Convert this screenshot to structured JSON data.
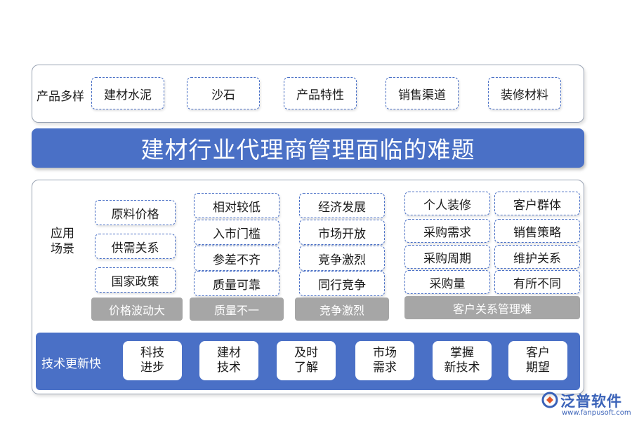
{
  "top": {
    "label": "产品多样",
    "items": [
      "建材水泥",
      "沙石",
      "产品特性",
      "销售渠道",
      "装修材料"
    ]
  },
  "title": "建材行业代理商管理面临的难题",
  "scenario": {
    "label_line1": "应用",
    "label_line2": "场景",
    "col1": {
      "items": [
        "原料价格",
        "供需关系",
        "国家政策"
      ],
      "footer": "价格波动大"
    },
    "col2": {
      "items": [
        "相对较低",
        "入市门槛",
        "参差不齐",
        "质量可靠"
      ],
      "footer": "质量不一"
    },
    "col3": {
      "items": [
        "经济发展",
        "市场开放",
        "竞争激烈",
        "同行竞争"
      ],
      "footer": "竞争激烈"
    },
    "col4": {
      "left": [
        "个人装修",
        "采购需求",
        "采购周期",
        "采购量"
      ],
      "right": [
        "客户群体",
        "销售策略",
        "维护关系",
        "有所不同"
      ],
      "footer": "客户关系管理难"
    }
  },
  "tech": {
    "label": "技术更新快",
    "items": [
      {
        "l1": "科技",
        "l2": "进步"
      },
      {
        "l1": "建材",
        "l2": "技术"
      },
      {
        "l1": "及时",
        "l2": "了解"
      },
      {
        "l1": "市场",
        "l2": "需求"
      },
      {
        "l1": "掌握",
        "l2": "新技术"
      },
      {
        "l1": "客户",
        "l2": "期望"
      }
    ]
  },
  "logo": {
    "name": "泛普软件",
    "url": "www.fanpusoft.com"
  },
  "colors": {
    "accent": "#4a70c6",
    "grey": "#a6a6a6"
  }
}
